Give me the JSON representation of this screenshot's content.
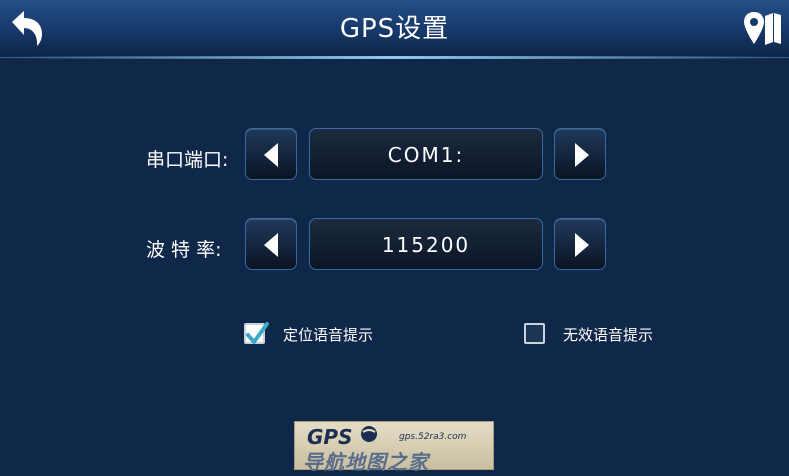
{
  "header": {
    "title": "GPS设置",
    "back_icon": "back-arrow-icon",
    "map_icon": "map-pin-icon"
  },
  "serial_port": {
    "label": "串口端口:",
    "value": "COM1:",
    "prev_icon": "arrow-left-icon",
    "next_icon": "arrow-right-icon"
  },
  "baud_rate": {
    "label": "波 特 率:",
    "value": "115200",
    "prev_icon": "arrow-left-icon",
    "next_icon": "arrow-right-icon"
  },
  "options": [
    {
      "label": "定位语音提示",
      "checked": true
    },
    {
      "label": "无效语音提示",
      "checked": false
    }
  ],
  "watermark": {
    "brand": "GPS",
    "url": "gps.52ra3.com",
    "name": "导航地图之家"
  },
  "colors": {
    "background": "#0f2748",
    "header": "#17386a",
    "button_border": "#3b6aa0",
    "check_mark": "#3fa8c8"
  }
}
